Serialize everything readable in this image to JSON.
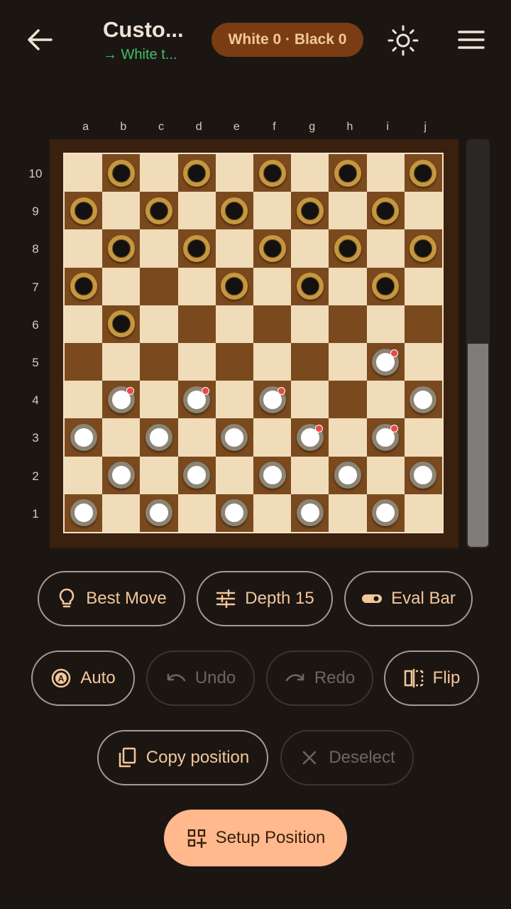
{
  "header": {
    "title": "Custo...",
    "subtitle": "→ White t...",
    "score": "White 0 · Black 0"
  },
  "board": {
    "files": [
      "a",
      "b",
      "c",
      "d",
      "e",
      "f",
      "g",
      "h",
      "i",
      "j"
    ],
    "ranks": [
      "10",
      "9",
      "8",
      "7",
      "6",
      "5",
      "4",
      "3",
      "2",
      "1"
    ],
    "pieces": [
      [
        null,
        "b",
        null,
        "b",
        null,
        "b",
        null,
        "b",
        null,
        "b"
      ],
      [
        "b",
        null,
        "b",
        null,
        "b",
        null,
        "b",
        null,
        "b",
        null
      ],
      [
        null,
        "b",
        null,
        "b",
        null,
        "b",
        null,
        "b",
        null,
        "b"
      ],
      [
        "b",
        null,
        null,
        null,
        "b",
        null,
        "b",
        null,
        "b",
        null
      ],
      [
        null,
        "b",
        null,
        null,
        null,
        null,
        null,
        null,
        null,
        null
      ],
      [
        null,
        null,
        null,
        null,
        null,
        null,
        null,
        null,
        "w*",
        null
      ],
      [
        null,
        "w*",
        null,
        "w*",
        null,
        "w*",
        null,
        null,
        null,
        "w"
      ],
      [
        "w",
        null,
        "w",
        null,
        "w",
        null,
        "w*",
        null,
        "w*",
        null
      ],
      [
        null,
        "w",
        null,
        "w",
        null,
        "w",
        null,
        "w",
        null,
        "w"
      ],
      [
        "w",
        null,
        "w",
        null,
        "w",
        null,
        "w",
        null,
        "w",
        null
      ]
    ]
  },
  "eval": {
    "white_fraction": 0.5
  },
  "controls": {
    "best_move": "Best Move",
    "depth": "Depth 15",
    "eval_bar": "Eval Bar",
    "auto": "Auto",
    "undo": "Undo",
    "redo": "Redo",
    "flip": "Flip",
    "copy_position": "Copy position",
    "deselect": "Deselect",
    "setup_position": "Setup Position"
  },
  "icons": {
    "back": "arrow-left-icon",
    "theme": "sun-icon",
    "menu": "hamburger-icon",
    "best_move": "lightbulb-icon",
    "depth": "sliders-icon",
    "eval_bar": "toggle-icon",
    "auto": "auto-play-icon",
    "undo": "undo-icon",
    "redo": "redo-icon",
    "flip": "flip-icon",
    "copy": "copy-icon",
    "deselect": "close-icon",
    "setup": "grid-plus-icon"
  },
  "colors": {
    "background": "#1c1613",
    "accent": "#f4c79a",
    "primary_button": "#ffb98c",
    "score_pill": "#7a3c12",
    "turn_indicator": "#3fbf6a",
    "legal_move_dot": "#e84a4a"
  }
}
